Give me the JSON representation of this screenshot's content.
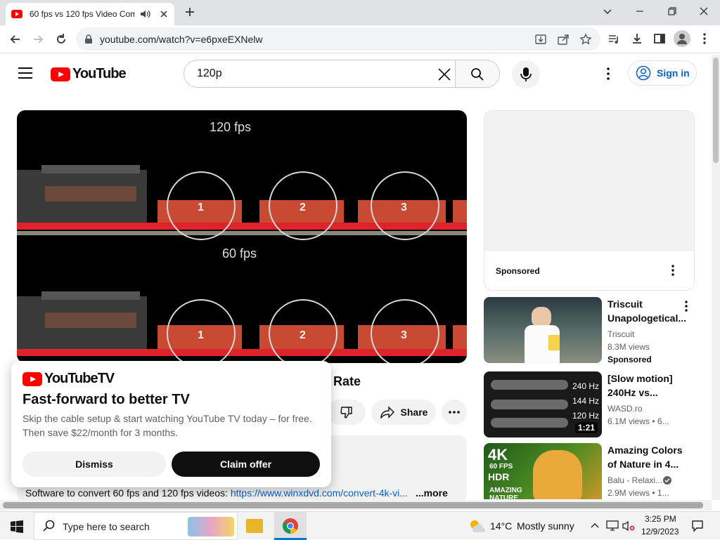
{
  "browser": {
    "tab_title": "60 fps vs 120 fps Video Com",
    "url": "youtube.com/watch?v=e6pxeEXNelw"
  },
  "header": {
    "logo_text": "YouTube",
    "search_query": "120p",
    "signin_label": "Sign in"
  },
  "player": {
    "top_label": "120 fps",
    "bottom_label": "60 fps",
    "car_numbers": [
      "1",
      "2",
      "3"
    ]
  },
  "video": {
    "title_tail": "Rate",
    "share_label": "Share",
    "description": "Software to convert 60 fps and 120 fps videos: ",
    "description_link": "https://www.winxdvd.com/convert-4k-vi...",
    "more_label": "...more"
  },
  "promo": {
    "brand": "YouTubeTV",
    "headline": "Fast-forward to better TV",
    "body_line1": "Skip the cable setup & start watching YouTube TV today – for free.",
    "body_line2": "Then save $22/month for 3 months.",
    "dismiss_label": "Dismiss",
    "claim_label": "Claim offer"
  },
  "sidebar": {
    "ad_label": "Sponsored",
    "recs": [
      {
        "title_l1": "Triscuit",
        "title_l2": "Unapologetical...",
        "channel": "Triscuit",
        "meta": "8.3M views",
        "badge": "Sponsored"
      },
      {
        "title_l1": "[Slow motion]",
        "title_l2": "240Hz vs...",
        "channel": "WASD.ro",
        "meta": "6.1M views  • 6...",
        "overlay": [
          "240 Hz",
          "144 Hz",
          "120 Hz"
        ],
        "duration": "1:21"
      },
      {
        "title_l1": "Amazing Colors",
        "title_l2": "of Nature in 4...",
        "channel": "Balu - Relaxi...",
        "meta": "2.9M views  • 1...",
        "thumb_tags": [
          "4K",
          "60 FPS",
          "HDR"
        ],
        "thumb_bottom": "AMAZING NATURE"
      }
    ]
  },
  "taskbar": {
    "search_placeholder": "Type here to search",
    "weather_temp": "14°C",
    "weather_text": "Mostly sunny",
    "time": "3:25 PM",
    "date": "12/9/2023"
  }
}
